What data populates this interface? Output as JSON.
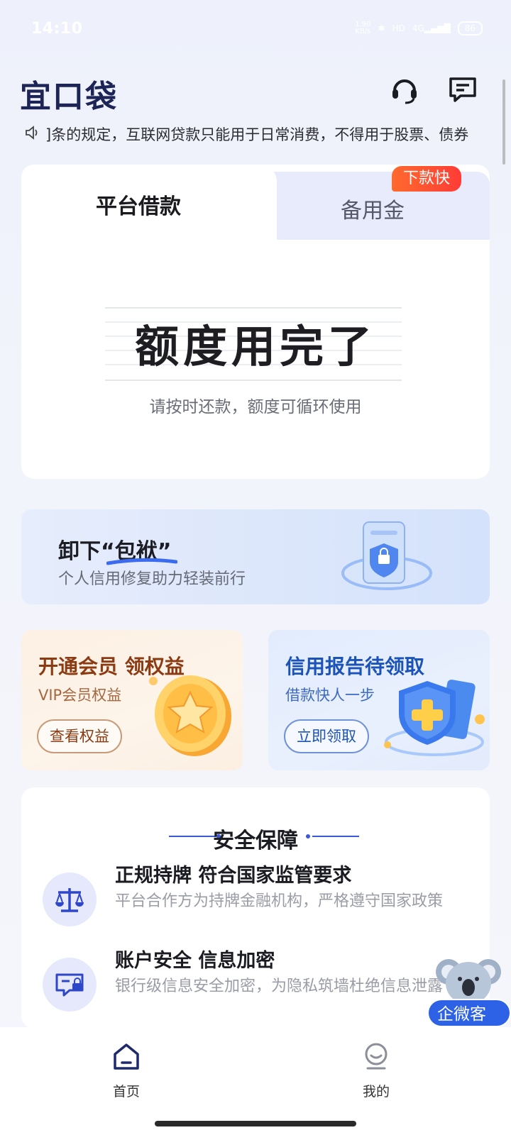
{
  "status_bar": {
    "time": "14:10",
    "net_speed": "1.90",
    "net_unit": "KB/s",
    "network": "4G",
    "hd": "HD",
    "battery": "86"
  },
  "header": {
    "logo": "宜口袋"
  },
  "notice": {
    "text": "]条的规定，互联网贷款只能用于日常消费，不得用于股票、债券"
  },
  "loan_card": {
    "tab_active": "平台借款",
    "tab_inactive": "备用金",
    "badge": "下款快",
    "title": "额度用完了",
    "subtitle": "请按时还款，额度可循环使用"
  },
  "credit_banner": {
    "title": "卸下“包袱”",
    "subtitle": "个人信用修复助力轻装前行"
  },
  "vip_card": {
    "title": "开通会员 领权益",
    "subtitle": "VIP会员权益",
    "button": "查看权益"
  },
  "report_card": {
    "title": "信用报告待领取",
    "subtitle": "借款快人一步",
    "button": "立即领取"
  },
  "security": {
    "title": "安全保障",
    "items": [
      {
        "title": "正规持牌 符合国家监管要求",
        "subtitle": "平台合作方为持牌金融机构，严格遵守国家政策",
        "icon": "scale-icon"
      },
      {
        "title": "账户安全 信息加密",
        "subtitle": "银行级信息安全加密，为隐私筑墙杜绝信息泄露",
        "icon": "secure-card-icon"
      }
    ]
  },
  "float_service": {
    "label": "企微客服"
  },
  "bottom_nav": [
    {
      "label": "首页",
      "icon": "home-icon",
      "active": true
    },
    {
      "label": "我的",
      "icon": "profile-icon",
      "active": false
    }
  ],
  "colors": {
    "accent": "#2d62e6",
    "brand_dark": "#1d2456",
    "badge": "#ff4a32"
  }
}
